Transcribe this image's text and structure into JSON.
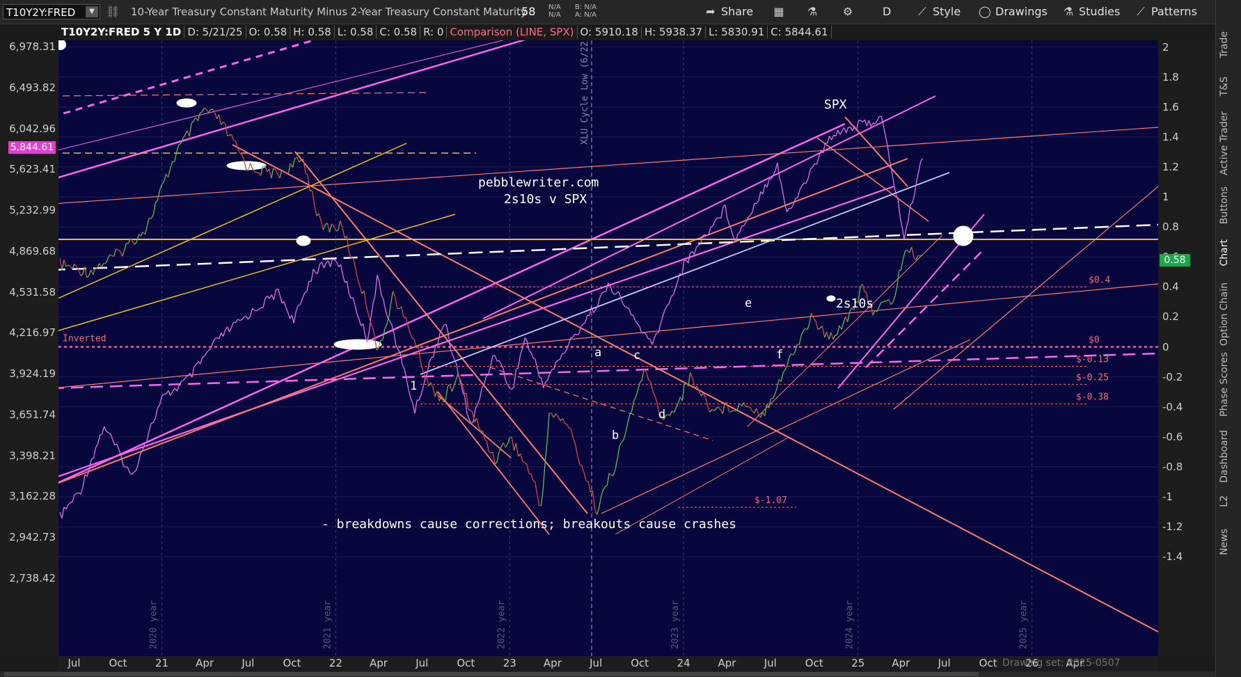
{
  "toolbar": {
    "symbol": "T10Y2Y:FRED",
    "title": "10-Year Treasury Constant Maturity Minus 2-Year Treasury Constant Maturity",
    "last": ".58",
    "bid_na": "N/A",
    "ask_na": "N/A",
    "bid_label": "B: N/A",
    "ask_label": "A: N/A",
    "share": "Share",
    "period": "D",
    "style": "Style",
    "drawings": "Drawings",
    "studies": "Studies",
    "patterns": "Patterns"
  },
  "infobar": {
    "symbol": "T10Y2Y:FRED 5 Y 1D",
    "date": "D: 5/21/25",
    "open": "O: 0.58",
    "high": "H: 0.58",
    "low": "L: 0.58",
    "close": "C: 0.58",
    "r": "R: 0",
    "comparison": "Comparison (LINE, SPX)",
    "c_open": "O: 5910.18",
    "c_high": "H: 5938.37",
    "c_low": "L: 5830.91",
    "c_close": "C: 5844.61"
  },
  "sidebar": [
    "Trade",
    "T&S",
    "Active Trader",
    "Buttons",
    "Chart",
    "Option Chain",
    "Phase Scores",
    "Dashboard",
    "L2",
    "News"
  ],
  "left_axis_labels": [
    "6,978.31",
    "6,493.82",
    "6,042.96",
    "5,623.41",
    "5,232.99",
    "4,869.68",
    "4,531.58",
    "4,216.97",
    "3,924.19",
    "3,651.74",
    "3,398.21",
    "3,162.28",
    "2,942.73",
    "2,738.42"
  ],
  "spx_price_tag": "5,844.61",
  "current_value_tag": "0.58",
  "drawing_set": "Drawing set: 2025-0507",
  "colors": {
    "background": "#07073d",
    "spx_line": "#e070e8",
    "spread_up": "#4ec24e",
    "spread_down": "#e04040",
    "trend_pink": "#ff66ee",
    "trend_salmon": "#ff7a6a",
    "trend_yellow": "#e8c020",
    "white_dash": "#ffffff"
  },
  "chart_data": {
    "type": "line",
    "title": "",
    "xlabel": "",
    "ylabel": "",
    "x_tick_labels": [
      "Jul",
      "Oct",
      "21",
      "Apr",
      "Jul",
      "Oct",
      "22",
      "Apr",
      "Jul",
      "Oct",
      "23",
      "Apr",
      "Jul",
      "Oct",
      "24",
      "Apr",
      "Jul",
      "Oct",
      "25",
      "Apr",
      "Jul",
      "Oct",
      "26",
      "Apr"
    ],
    "y_right_ticks": [
      2,
      1.8,
      1.6,
      1.4,
      1.2,
      1,
      0.8,
      0.6,
      0.4,
      0.2,
      0,
      -0.2,
      -0.4,
      -0.6,
      -0.8,
      -1,
      -1.2,
      -1.4
    ],
    "y_right_range": [
      -1.5,
      2.05
    ],
    "y_left_range_spx": [
      2650,
      7100
    ],
    "log_scale_left": true,
    "grid": true,
    "year_markers": [
      "2020 year",
      "2021 year",
      "2022 year",
      "2023 year",
      "2024 year",
      "2025 year"
    ],
    "series": [
      {
        "name": "T10Y2Y:FRED",
        "points": [
          [
            "2020-06-01",
            0.55
          ],
          [
            "2020-08-01",
            0.5
          ],
          [
            "2020-10-01",
            0.62
          ],
          [
            "2020-12-01",
            0.8
          ],
          [
            "2021-02-01",
            1.3
          ],
          [
            "2021-03-31",
            1.58
          ],
          [
            "2021-05-01",
            1.52
          ],
          [
            "2021-07-01",
            1.2
          ],
          [
            "2021-09-01",
            1.15
          ],
          [
            "2021-10-25",
            1.25
          ],
          [
            "2021-12-01",
            0.8
          ],
          [
            "2022-01-15",
            0.8
          ],
          [
            "2022-03-15",
            0.2
          ],
          [
            "2022-04-01",
            -0.05
          ],
          [
            "2022-05-01",
            0.35
          ],
          [
            "2022-06-15",
            0.05
          ],
          [
            "2022-07-15",
            -0.25
          ],
          [
            "2022-08-15",
            -0.35
          ],
          [
            "2022-09-15",
            -0.2
          ],
          [
            "2022-10-15",
            -0.45
          ],
          [
            "2022-12-01",
            -0.75
          ],
          [
            "2023-01-01",
            -0.6
          ],
          [
            "2023-02-15",
            -0.85
          ],
          [
            "2023-03-08",
            -1.07
          ],
          [
            "2023-03-25",
            -0.45
          ],
          [
            "2023-05-01",
            -0.5
          ],
          [
            "2023-07-03",
            -1.08
          ],
          [
            "2023-08-15",
            -0.75
          ],
          [
            "2023-10-10",
            -0.15
          ],
          [
            "2023-11-20",
            -0.5
          ],
          [
            "2023-12-25",
            -0.35
          ],
          [
            "2024-01-15",
            -0.2
          ],
          [
            "2024-03-01",
            -0.42
          ],
          [
            "2024-05-15",
            -0.38
          ],
          [
            "2024-06-15",
            -0.45
          ],
          [
            "2024-08-01",
            -0.15
          ],
          [
            "2024-09-25",
            0.2
          ],
          [
            "2024-11-01",
            0.05
          ],
          [
            "2024-12-10",
            0.2
          ],
          [
            "2025-01-10",
            0.38
          ],
          [
            "2025-02-01",
            0.25
          ],
          [
            "2025-03-15",
            0.3
          ],
          [
            "2025-04-10",
            0.65
          ],
          [
            "2025-05-21",
            0.58
          ]
        ]
      },
      {
        "name": "SPX",
        "points": [
          [
            "2020-06-01",
            3050
          ],
          [
            "2020-07-15",
            3200
          ],
          [
            "2020-09-02",
            3580
          ],
          [
            "2020-10-30",
            3270
          ],
          [
            "2021-01-01",
            3750
          ],
          [
            "2021-03-01",
            3900
          ],
          [
            "2021-05-01",
            4180
          ],
          [
            "2021-07-01",
            4350
          ],
          [
            "2021-09-02",
            4530
          ],
          [
            "2021-10-05",
            4300
          ],
          [
            "2021-11-15",
            4700
          ],
          [
            "2022-01-03",
            4800
          ],
          [
            "2022-03-08",
            4170
          ],
          [
            "2022-03-29",
            4630
          ],
          [
            "2022-06-16",
            3670
          ],
          [
            "2022-08-16",
            4300
          ],
          [
            "2022-10-12",
            3580
          ],
          [
            "2022-12-01",
            4080
          ],
          [
            "2023-01-05",
            3800
          ],
          [
            "2023-02-02",
            4180
          ],
          [
            "2023-03-13",
            3850
          ],
          [
            "2023-07-31",
            4590
          ],
          [
            "2023-10-27",
            4120
          ],
          [
            "2024-01-02",
            4750
          ],
          [
            "2024-03-28",
            5250
          ],
          [
            "2024-04-19",
            4970
          ],
          [
            "2024-07-16",
            5670
          ],
          [
            "2024-08-05",
            5190
          ],
          [
            "2024-11-11",
            6000
          ],
          [
            "2025-02-19",
            6145
          ],
          [
            "2025-04-08",
            4980
          ],
          [
            "2025-05-21",
            5844.61
          ]
        ]
      }
    ],
    "annotations": {
      "site": "pebblewriter.com",
      "subtitle": "2s10s v SPX",
      "spx_label": "SPX",
      "spread_label": "2s10s",
      "note": "- breakdowns cause corrections; breakouts cause crashes",
      "xlu": "XLU Cycle Low (6/22/23)",
      "inverted": "Inverted",
      "waves": [
        "1",
        "a",
        "b",
        "c",
        "d",
        "e",
        "f"
      ],
      "levels": [
        "$0.4",
        "$0",
        "$-0.13",
        "$-0.25",
        "$-0.38",
        "$-1.07"
      ]
    }
  }
}
